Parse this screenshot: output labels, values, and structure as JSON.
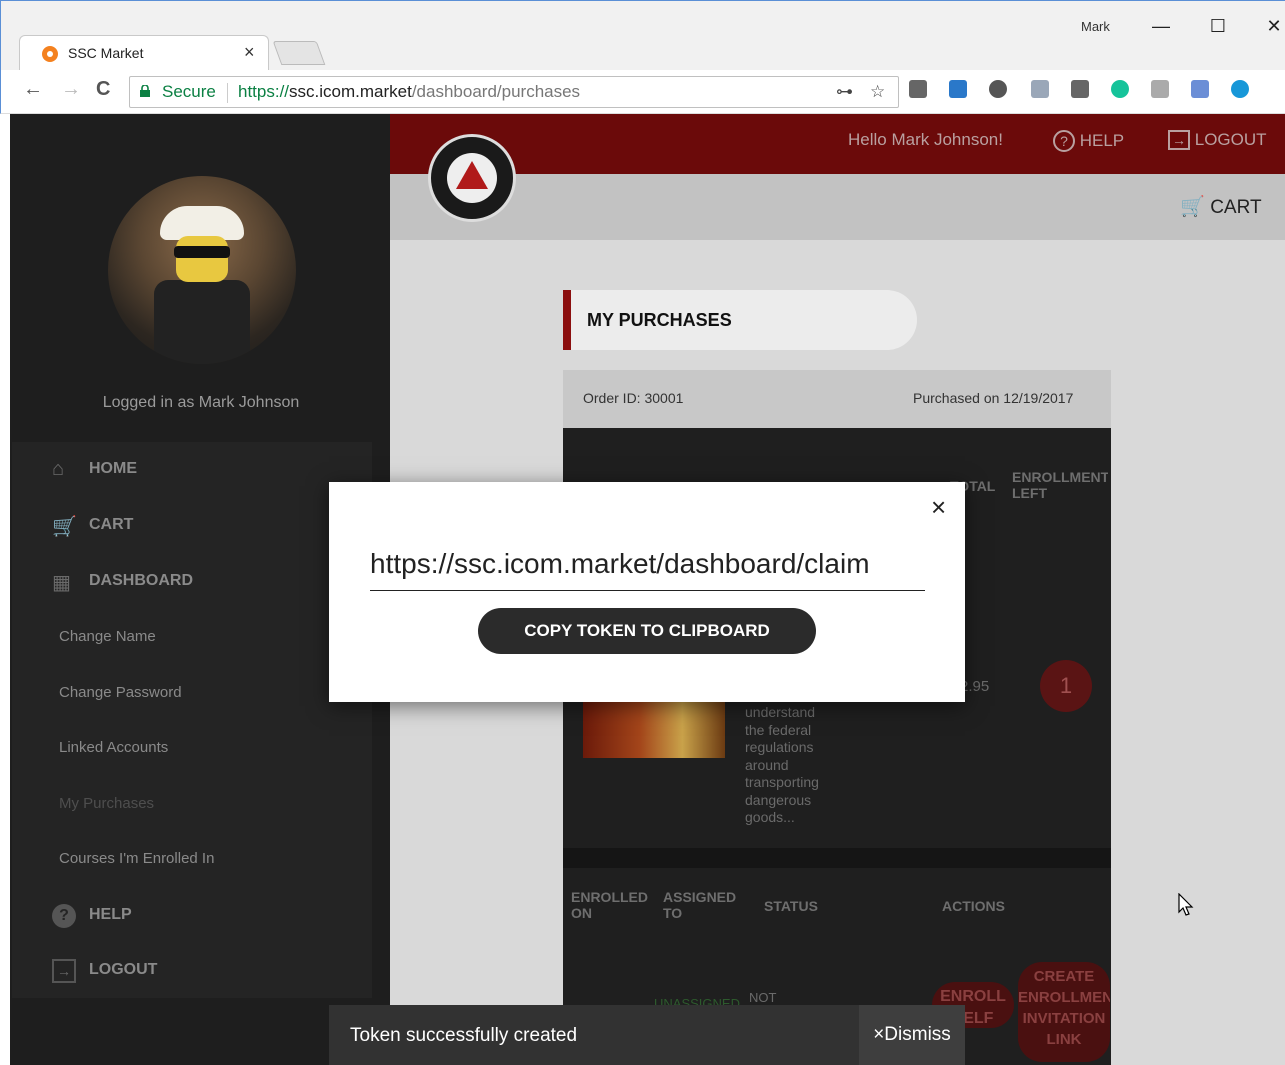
{
  "browser": {
    "tab_title": "SSC Market",
    "tab_close": "×",
    "window_user": "Mark",
    "window_buttons": {
      "minimize": "—",
      "maximize": "☐",
      "close": "✕"
    },
    "nav": {
      "back": "←",
      "forward": "→",
      "reload": "C"
    },
    "secure_label": "Secure",
    "url_scheme": "https://",
    "url_host": "ssc.icom.market",
    "url_path": "/dashboard/purchases"
  },
  "header": {
    "greeting": "Hello Mark Johnson!",
    "help": "HELP",
    "logout": "LOGOUT",
    "cart": "CART"
  },
  "sidebar": {
    "logged_in": "Logged in as Mark Johnson",
    "items": [
      {
        "label": "HOME",
        "icon": "home-icon"
      },
      {
        "label": "CART",
        "icon": "cart-icon"
      },
      {
        "label": "DASHBOARD",
        "icon": "dashboard-icon"
      }
    ],
    "sub_items": [
      "Change Name",
      "Change Password",
      "Linked Accounts",
      "My Purchases",
      "Courses I'm Enrolled In"
    ],
    "bottom_items": [
      {
        "label": "HELP",
        "icon": "help-icon"
      },
      {
        "label": "LOGOUT",
        "icon": "logout-icon"
      }
    ]
  },
  "purchases": {
    "title": "MY PURCHASES",
    "order_id": "Order ID: 30001",
    "purchased_on": "Purchased on 12/19/2017",
    "columns": {
      "total": "TOTAL",
      "enrollments_left": "ENROLLMENTS LEFT"
    },
    "description_lines": [
      "understand",
      "the federal",
      "regulations",
      "around",
      "transporting",
      "dangerous",
      "goods..."
    ],
    "total_value": "2.95",
    "enrollments_left_value": "1",
    "sub_columns": {
      "enrolled_on": "ENROLLED ON",
      "assigned_to": "ASSIGNED TO",
      "status": "STATUS",
      "actions": "ACTIONS"
    },
    "status_unassigned": "UNASSIGNED",
    "status_not": "NOT",
    "enroll_self": "ENROLL SELF",
    "create_link": "CREATE ENROLLMENT INVITATION LINK"
  },
  "modal": {
    "token_url": "https://ssc.icom.market/dashboard/claim",
    "copy_button": "COPY TOKEN TO CLIPBOARD",
    "close": "×"
  },
  "snackbar": {
    "message": "Token successfully created",
    "dismiss": "Dismiss",
    "dismiss_icon": "×"
  },
  "colors": {
    "header_red": "#6b0a0a",
    "sidebar_bg": "#1e1e1e",
    "accent_red": "#8b0e0e",
    "secure_green": "#0b8043"
  }
}
